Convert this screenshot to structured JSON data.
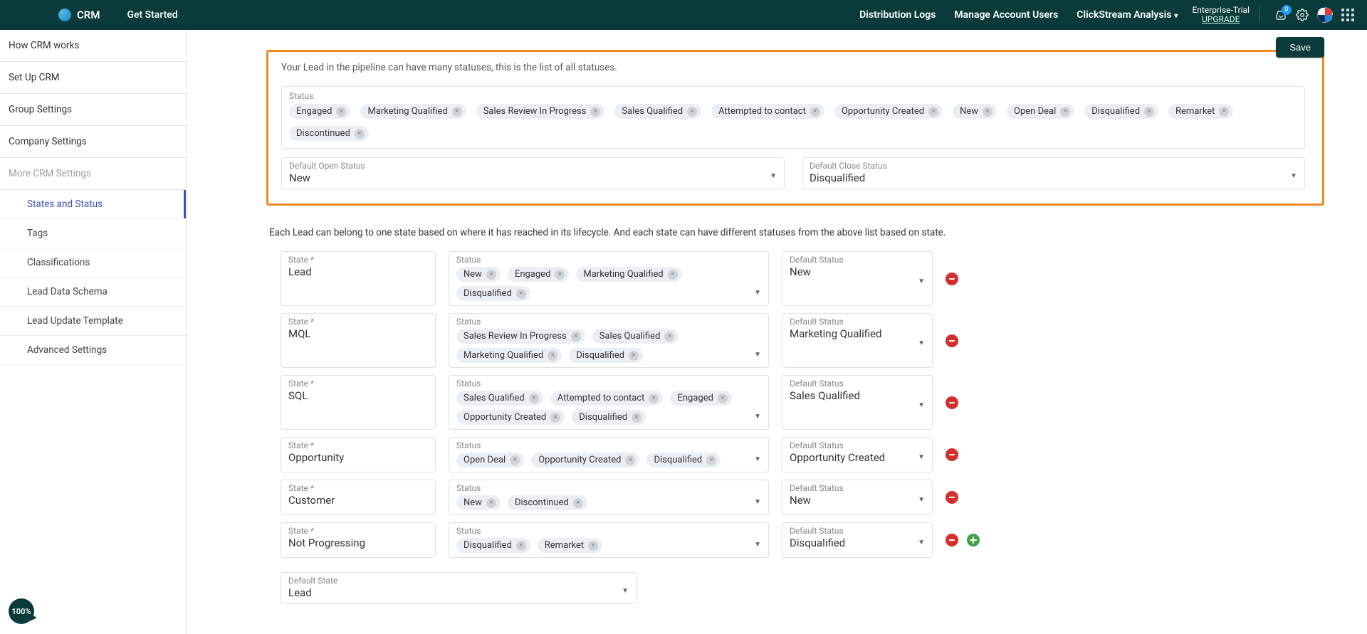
{
  "header": {
    "brand": "CRM",
    "get_started": "Get Started",
    "nav": {
      "dist_logs": "Distribution Logs",
      "manage_users": "Manage Account Users",
      "clickstream": "ClickStream Analysis"
    },
    "trial": {
      "line1": "Enterprise-Trial",
      "upgrade": "UPGRADE"
    },
    "inbox_count": "0"
  },
  "sidebar": {
    "items": [
      "How CRM works",
      "Set Up CRM",
      "Group Settings",
      "Company Settings",
      "More CRM Settings"
    ],
    "sub": [
      "States and Status",
      "Tags",
      "Classifications",
      "Lead Data Schema",
      "Lead Update Template",
      "Advanced Settings"
    ]
  },
  "main": {
    "save": "Save",
    "intro1": "Your Lead in the pipeline can have many statuses, this is the list of all statuses.",
    "status_label": "Status",
    "statuses": [
      "Engaged",
      "Marketing Qualified",
      "Sales Review In Progress",
      "Sales Qualified",
      "Attempted to contact",
      "Opportunity Created",
      "New",
      "Open Deal",
      "Disqualified",
      "Remarket",
      "Discontinued"
    ],
    "default_open_lbl": "Default Open Status",
    "default_open_val": "New",
    "default_close_lbl": "Default Close Status",
    "default_close_val": "Disqualified",
    "intro2": "Each Lead can belong to one state based on where it has reached in its lifecycle. And each state can have different statuses from the above list based on state.",
    "state_lbl": "State *",
    "status_col_lbl": "Status",
    "default_status_lbl": "Default Status",
    "rows": [
      {
        "state": "Lead",
        "statuses": [
          "New",
          "Engaged",
          "Marketing Qualified",
          "Disqualified"
        ],
        "default": "New"
      },
      {
        "state": "MQL",
        "statuses": [
          "Sales Review In Progress",
          "Sales Qualified",
          "Marketing Qualified",
          "Disqualified"
        ],
        "default": "Marketing Qualified"
      },
      {
        "state": "SQL",
        "statuses": [
          "Sales Qualified",
          "Attempted to contact",
          "Engaged",
          "Opportunity Created",
          "Disqualified"
        ],
        "default": "Sales Qualified"
      },
      {
        "state": "Opportunity",
        "statuses": [
          "Open Deal",
          "Opportunity Created",
          "Disqualified"
        ],
        "default": "Opportunity Created"
      },
      {
        "state": "Customer",
        "statuses": [
          "New",
          "Discontinued"
        ],
        "default": "New"
      },
      {
        "state": "Not Progressing",
        "statuses": [
          "Disqualified",
          "Remarket"
        ],
        "default": "Disqualified"
      }
    ],
    "default_state_lbl": "Default State",
    "default_state_val": "Lead",
    "progress": "100%"
  }
}
